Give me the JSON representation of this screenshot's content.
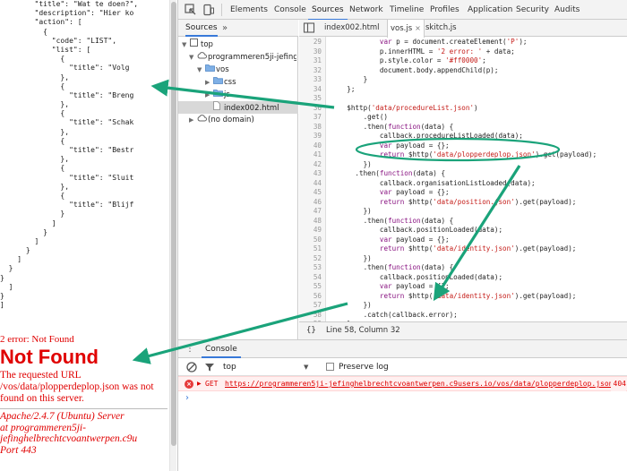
{
  "page": {
    "json_lines": [
      "        \"title\": \"Wat te doen?\",",
      "        \"description\": \"Hier ko",
      "        \"action\": [",
      "          {",
      "            \"code\": \"LIST\",",
      "            \"list\": [",
      "              {",
      "                \"title\": \"Volg",
      "              },",
      "              {",
      "                \"title\": \"Breng",
      "              },",
      "              {",
      "                \"title\": \"Schak",
      "              },",
      "              {",
      "                \"title\": \"Bestr",
      "              },",
      "              {",
      "                \"title\": \"Sluit",
      "              },",
      "              {",
      "                \"title\": \"Blijf",
      "              }",
      "            ]",
      "          }",
      "        ]",
      "      }",
      "    ]",
      "  }",
      "}",
      "  ]",
      "}",
      "]"
    ],
    "error_line": "2 error: Not Found",
    "not_found_title": "Not Found",
    "not_found_message": "The requested URL /vos/data/plopperdeplop.json was not found on this server.",
    "server_info": "Apache/2.4.7 (Ubuntu) Server\nat programmeren5ji-\njefinghelbrechtcvoantwerpen.c9u\nPort 443"
  },
  "devtools": {
    "tabs": [
      "Elements",
      "Console",
      "Sources",
      "Network",
      "Timeline",
      "Profiles",
      "Application",
      "Security",
      "Audits"
    ],
    "active_tab": "Sources",
    "navigator": {
      "header_label": "Sources",
      "more_label": "»",
      "tree": [
        {
          "label": "top",
          "icon": "frame-icon"
        },
        {
          "label": "programmeren5ji-jefinghelbrechtcvoantwerpen.c9users.io",
          "icon": "cloud-icon"
        },
        {
          "label": "vos",
          "icon": "folder-icon"
        },
        {
          "label": "css",
          "icon": "folder-icon"
        },
        {
          "label": "js",
          "icon": "folder-icon"
        },
        {
          "label": "index002.html",
          "icon": "file-icon"
        },
        {
          "label": "(no domain)",
          "icon": "cloud-icon"
        }
      ]
    },
    "editor": {
      "tabs": [
        "index002.html",
        "vos.js",
        "skitch.js"
      ],
      "active_tab": "vos.js",
      "close_glyph": "×",
      "lines": [
        {
          "n": "29",
          "t": "            var p = document.createElement('P');"
        },
        {
          "n": "30",
          "t": "            p.innerHTML = '2 error: ' + data;"
        },
        {
          "n": "31",
          "t": "            p.style.color = '#ff0000';"
        },
        {
          "n": "32",
          "t": "            document.body.appendChild(p);"
        },
        {
          "n": "33",
          "t": "        }"
        },
        {
          "n": "34",
          "t": "    };"
        },
        {
          "n": "35",
          "t": ""
        },
        {
          "n": "36",
          "t": "    $http('data/procedureList.json')"
        },
        {
          "n": "37",
          "t": "        .get()"
        },
        {
          "n": "38",
          "t": "        .then(function(data) {"
        },
        {
          "n": "39",
          "t": "            callback.procedureListLoaded(data);"
        },
        {
          "n": "40",
          "t": "            var payload = {};"
        },
        {
          "n": "41",
          "t": "            return $http('data/plopperdeplop.json').get(payload);"
        },
        {
          "n": "42",
          "t": "        })"
        },
        {
          "n": "43",
          "t": "      .then(function(data) {"
        },
        {
          "n": "44",
          "t": "            callback.organisationListLoaded(data);"
        },
        {
          "n": "45",
          "t": "            var payload = {};"
        },
        {
          "n": "46",
          "t": "            return $http('data/position.json').get(payload);"
        },
        {
          "n": "47",
          "t": "        })"
        },
        {
          "n": "48",
          "t": "        .then(function(data) {"
        },
        {
          "n": "49",
          "t": "            callback.positionLoaded(data);"
        },
        {
          "n": "50",
          "t": "            var payload = {};"
        },
        {
          "n": "51",
          "t": "            return $http('data/identity.json').get(payload);"
        },
        {
          "n": "52",
          "t": "        })"
        },
        {
          "n": "53",
          "t": "        .then(function(data) {"
        },
        {
          "n": "54",
          "t": "            callback.positionLoaded(data);"
        },
        {
          "n": "55",
          "t": "            var payload = {};"
        },
        {
          "n": "56",
          "t": "            return $http('data/identity.json').get(payload);"
        },
        {
          "n": "57",
          "t": "        })"
        },
        {
          "n": "58",
          "t": "        .catch(callback.error);"
        },
        {
          "n": "59",
          "t": "    }"
        }
      ],
      "status_brace": "{}",
      "status_position": "Line 58, Column 32"
    },
    "console": {
      "tab_label": "Console",
      "menu_glyph": "⋮",
      "context": "top",
      "preserve_log_label": "Preserve log",
      "error_method": "GET",
      "error_url": "https://programmeren5ji-jefinghelbrechtcvoantwerpen.c9users.io/vos/data/plopperdeplop.json",
      "error_status": "404",
      "prompt_glyph": "›"
    }
  },
  "colors": {
    "error_red": "#e00000",
    "annotation_green": "#1aa37a",
    "accent_blue": "#3879d9"
  }
}
